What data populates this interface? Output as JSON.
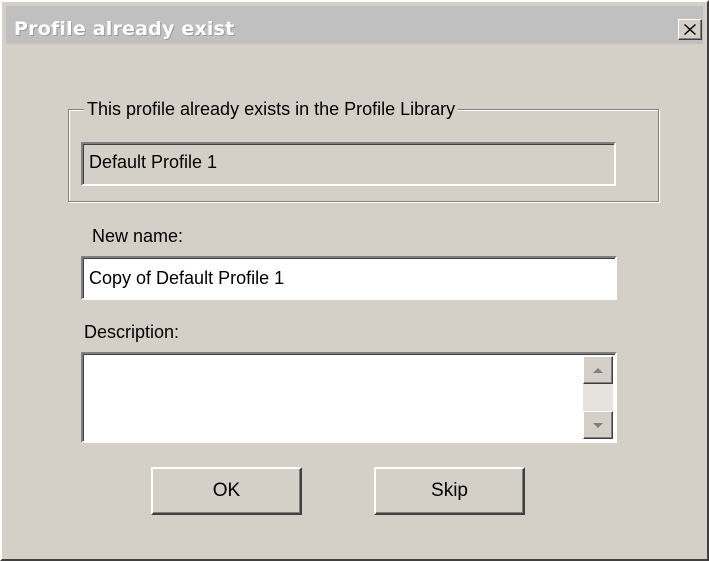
{
  "window": {
    "title": "Profile already exist",
    "close_glyph": "✕"
  },
  "existing_group": {
    "legend": "This profile already exists in the Profile Library",
    "existing_name": "Default Profile 1"
  },
  "new_name": {
    "label": "New name:",
    "value": "Copy of Default Profile 1"
  },
  "description": {
    "label": "Description:",
    "value": ""
  },
  "buttons": {
    "ok": "OK",
    "skip": "Skip"
  },
  "icons": {
    "close": "close-icon",
    "scroll_up": "arrow-up-icon",
    "scroll_down": "arrow-down-icon"
  }
}
